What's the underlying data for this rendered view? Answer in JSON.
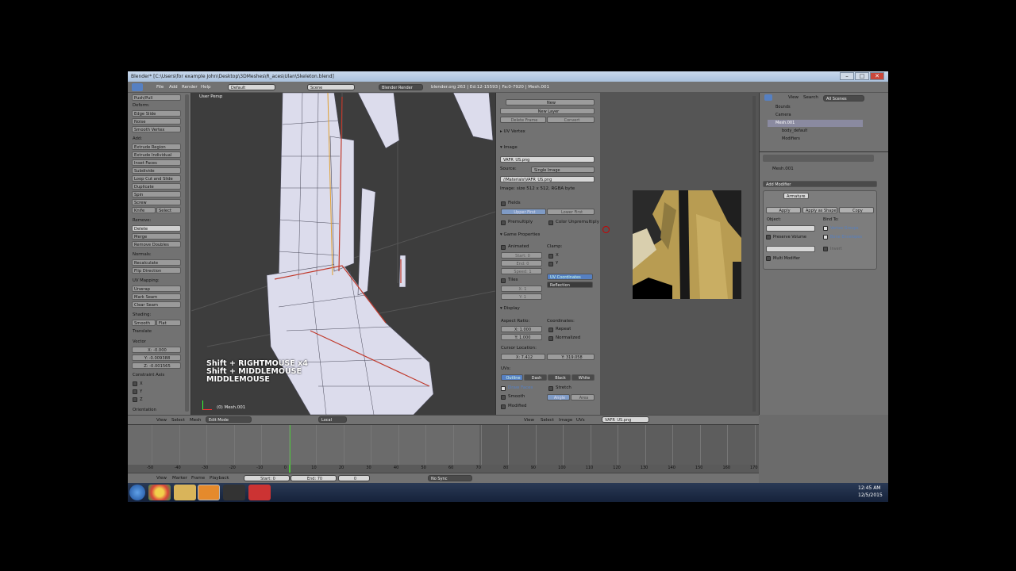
{
  "window": {
    "title": "Blender* [C:\\Users\\for example John\\Desktop\\3DMeshes\\R_aces\\Ulan\\Skeleton.blend]",
    "minimize": "–",
    "maximize": "□",
    "close": "✕"
  },
  "menubar": {
    "menus": [
      "File",
      "Add",
      "Render",
      "Help"
    ],
    "layout": "Default",
    "scene": "Scene",
    "engine": "Blender Render",
    "stats": "blender.org 263 | Ed:12-15593 | Fa:0-7920 | Mesh.001"
  },
  "toolshelf": {
    "top_button": "Push/Pull",
    "deform_label": "Deform:",
    "deform": [
      "Edge Slide",
      "Noise",
      "Smooth Vertex"
    ],
    "add_label": "Add:",
    "add": [
      "Extrude Region",
      "Extrude Individual",
      "Inset Faces",
      "Subdivide",
      "Loop Cut and Slide",
      "Duplicate",
      "Spin",
      "Screw"
    ],
    "knife": "Knife",
    "select": "Select",
    "remove_label": "Remove:",
    "delete": "Delete",
    "merge": "Merge",
    "remove_doubles": "Remove Doubles",
    "normals_label": "Normals:",
    "normals": [
      "Recalculate",
      "Flip Direction"
    ],
    "uv_label": "UV Mapping:",
    "uv": [
      "Unwrap",
      "Mark Seam",
      "Clear Seam"
    ],
    "shading_label": "Shading:",
    "smooth": "Smooth",
    "flat": "Flat",
    "translate_label": "Translate",
    "vector_label": "Vector",
    "vector": [
      "X: -0.000",
      "Y: -0.009388",
      "Z: -0.001565"
    ],
    "constraint_label": "Constraint Axis",
    "axes": [
      "X",
      "Y",
      "Z"
    ],
    "orientation_label": "Orientation"
  },
  "viewport": {
    "view_name": "User Persp",
    "overlay_lines": [
      "Shift + RIGHTMOUSE x4",
      "Shift + MIDDLEMOUSE",
      "MIDDLEMOUSE"
    ],
    "object_label": "(0) Mesh.001",
    "footer": {
      "view": "View",
      "select": "Select",
      "mesh": "Mesh",
      "mode": "Edit Mode",
      "pivot": "Local"
    }
  },
  "image_panel": {
    "new": "New",
    "new_layer": "New Layer",
    "delete_frame": "Delete Frame",
    "convert": "Convert",
    "uv_vertex": "UV Vertex",
    "image_header": "Image",
    "image_name": "VAFR_US.png",
    "source_label": "Source:",
    "source": "Single Image",
    "path": "//Materials\\VAFR_US.png",
    "image_size": "Image: size 512 x 512, RGBA byte",
    "fields": "Fields",
    "upper_first": "Upper First",
    "lower_first": "Lower First",
    "premultiply": "Premultiply",
    "color_unpremultiply": "Color Unpremultiply",
    "game_props": "Game Properties",
    "animated": "Animated",
    "clamp": "Clamp:",
    "start": "Start: 0",
    "end": "End: 0",
    "speed": "Speed: 1",
    "clamp_x": "X",
    "clamp_y": "Y",
    "tiles": "Tiles",
    "tiles_x": "X: 1",
    "tiles_y": "Y: 1",
    "uv_coordinates": "UV Coordinates",
    "reflection": "Reflection",
    "display_header": "Display",
    "aspect_label": "Aspect Ratio:",
    "aspect_x": "X: 1.000",
    "aspect_y": "Y: 1.000",
    "coordinates_label": "Coordinates:",
    "repeat": "Repeat",
    "normalized": "Normalized",
    "cursor_label": "Cursor Location:",
    "cursor_x": "X: 7.412",
    "cursor_y": "Y: 319.058",
    "uvs_label": "UVs:",
    "uv_styles": [
      "Outline",
      "Dash",
      "Black",
      "White"
    ],
    "draw_faces": "Draw Faces",
    "stretch": "Stretch",
    "smooth": "Smooth",
    "angle": "Angle",
    "area": "Area",
    "modified": "Modified"
  },
  "image_editor": {
    "footer": {
      "view": "View",
      "select": "Select",
      "image": "Image",
      "uvs": "UVs",
      "image_name": "VAFR_US.png"
    }
  },
  "outliner": {
    "view": "View",
    "search": "Search",
    "scenes": "All Scenes",
    "items": [
      "Bounds",
      "Camera",
      "Mesh.001",
      "body_default",
      "Modifiers"
    ]
  },
  "properties": {
    "object": "Mesh.001",
    "add_modifier": "Add Modifier",
    "modifier_name": "Armature",
    "apply": "Apply",
    "apply_as_shape": "Apply as Shape K",
    "copy": "Copy",
    "object_label": "Object:",
    "bind_to": "Bind To:",
    "vertex_groups": "Vertex Groups",
    "preserve_volume": "Preserve Volume",
    "bone_envelopes": "Bone Envelopes",
    "invert": "Invert",
    "multi_modifier": "Multi Modifier"
  },
  "timeline": {
    "ticks": [
      "-50",
      "-40",
      "-30",
      "-20",
      "-10",
      "0",
      "10",
      "20",
      "30",
      "40",
      "50",
      "60",
      "70",
      "80",
      "90",
      "100",
      "110",
      "120",
      "130",
      "140",
      "150",
      "160",
      "170"
    ],
    "current_frame": 0,
    "view": "View",
    "marker": "Marker",
    "frame": "Frame",
    "playback": "Playback",
    "start": "Start: 0",
    "end": "End: 70",
    "frame_value": "0",
    "sync": "No Sync"
  },
  "taskbar": {
    "time": "12:45 AM",
    "date": "12/5/2015"
  },
  "colors": {
    "accent": "#5680c2",
    "seam": "#c0392b",
    "panel": "#727272",
    "viewport": "#3d3d3d"
  }
}
